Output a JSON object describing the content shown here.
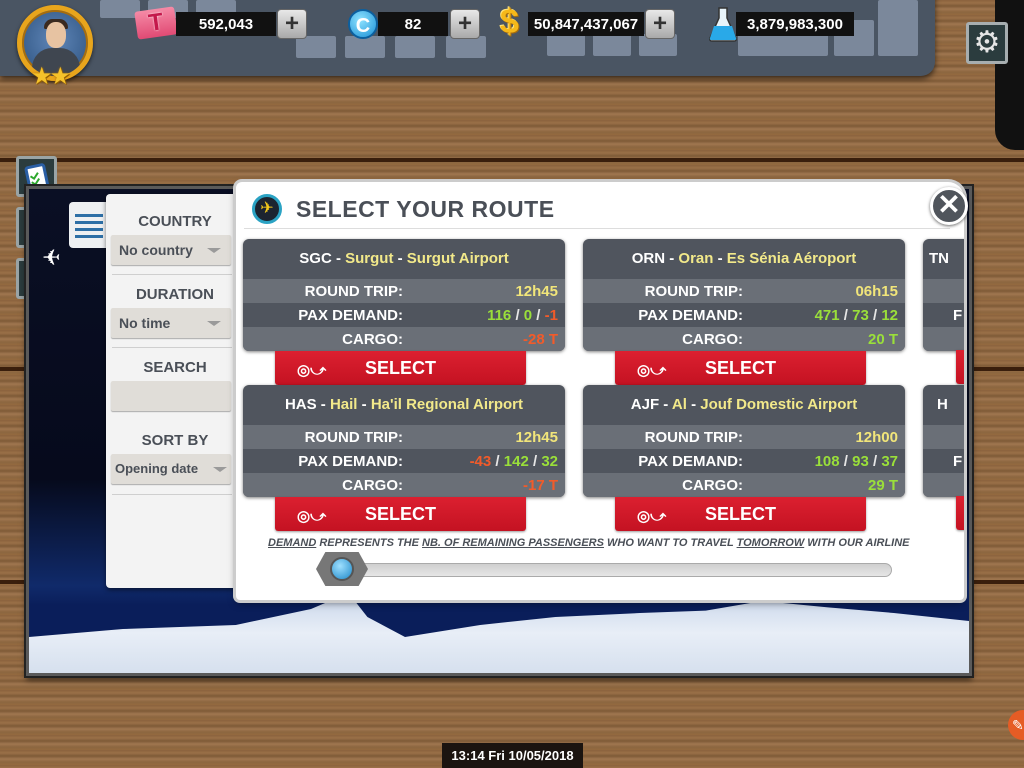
{
  "hud": {
    "player_stars": "★★",
    "tshirts": {
      "icon": "tshirt-icon",
      "value": "592,043",
      "plus": "+"
    },
    "coins": {
      "icon": "coin-icon",
      "glyph": "C",
      "value": "82",
      "plus": "+"
    },
    "cash": {
      "icon": "dollar-icon",
      "glyph": "$",
      "value": "50,847,437,067",
      "plus": "+"
    },
    "research": {
      "icon": "flask-icon",
      "value": "3,879,983,300"
    },
    "settings_icon": "⚙"
  },
  "side_buttons": [
    {
      "name": "clipboard-icon",
      "glyph": "📋"
    },
    {
      "name": "finance-icon",
      "glyph": "$"
    },
    {
      "name": "help-icon",
      "glyph": "?"
    }
  ],
  "filters": {
    "country_label": "COUNTRY",
    "country_value": "No country",
    "duration_label": "DURATION",
    "duration_value": "No time",
    "search_label": "SEARCH",
    "search_value": "",
    "sort_label": "SORT BY",
    "sort_value": "Opening date"
  },
  "dialog": {
    "title": "SELECT YOUR ROUTE",
    "close": "✕",
    "labels": {
      "round_trip": "ROUND TRIP:",
      "pax_demand": "PAX DEMAND:",
      "cargo": "CARGO:",
      "select": "SELECT"
    },
    "routes": [
      {
        "code": "SGC",
        "city": "Surgut",
        "airport": "Surgut Airport",
        "round_trip": "12h45",
        "pax": [
          "116",
          "0",
          "-1"
        ],
        "pax_colors": [
          "green",
          "green",
          "red"
        ],
        "cargo": "-28 T",
        "cargo_color": "red"
      },
      {
        "code": "ORN",
        "city": "Oran",
        "airport": "Es Sénia Aéroport",
        "round_trip": "06h15",
        "pax": [
          "471",
          "73",
          "12"
        ],
        "pax_colors": [
          "green",
          "green",
          "green"
        ],
        "cargo": "20 T",
        "cargo_color": "green"
      },
      {
        "code": "HAS",
        "city": "Hail",
        "airport": "Ha'il Regional Airport",
        "round_trip": "12h45",
        "pax": [
          "-43",
          "142",
          "32"
        ],
        "pax_colors": [
          "red",
          "green",
          "green"
        ],
        "cargo": "-17 T",
        "cargo_color": "red"
      },
      {
        "code": "AJF",
        "city": "Al",
        "airport": "Jouf Domestic Airport",
        "round_trip": "12h00",
        "pax": [
          "108",
          "93",
          "37"
        ],
        "pax_colors": [
          "green",
          "green",
          "green"
        ],
        "cargo": "29 T",
        "cargo_color": "green"
      }
    ],
    "partial_cards": [
      {
        "code_fragment": "TN",
        "row_fragment": "F"
      },
      {
        "code_fragment": "H",
        "row_fragment": "F"
      }
    ],
    "note": {
      "part1": "DEMAND",
      "part2": " REPRESENTS THE ",
      "part3": "NB. OF REMAINING PASSENGERS",
      "part4": " WHO WANT TO TRAVEL ",
      "part5": "TOMORROW",
      "part6": " WITH OUR AIRLINE"
    },
    "scroll_position_percent": 0
  },
  "footer": {
    "clock": "13:14 Fri 10/05/2018"
  },
  "colors": {
    "green": "#9adf3a",
    "red": "#f25b2a",
    "yellow": "#f1e57a",
    "select_red": "#d01a2a",
    "card_bg": "#50555e"
  }
}
